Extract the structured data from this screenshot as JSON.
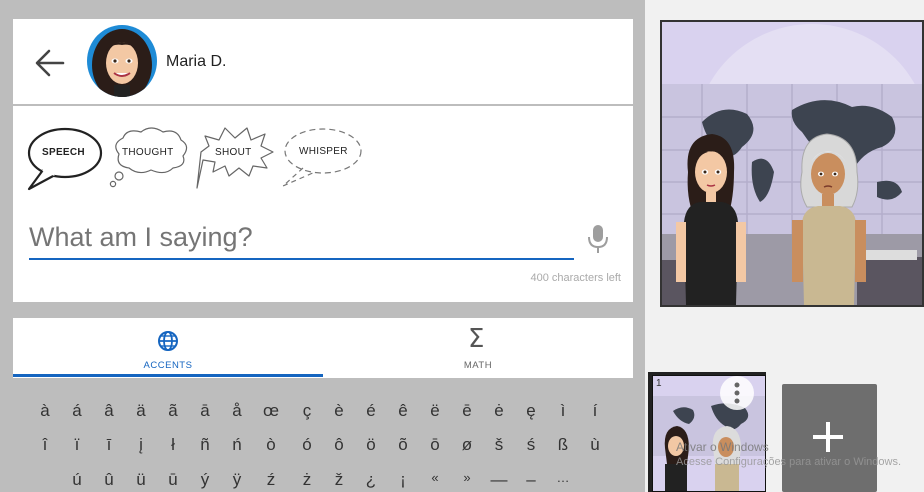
{
  "character": {
    "name": "Maria D."
  },
  "bubbles": [
    "SPEECH",
    "THOUGHT",
    "SHOUT",
    "WHISPER"
  ],
  "input": {
    "placeholder": "What am I saying?",
    "chars_left": "400 characters left"
  },
  "tabs": [
    {
      "label": "ACCENTS"
    },
    {
      "label": "MATH"
    }
  ],
  "keyboard": {
    "row1": [
      "à",
      "á",
      "â",
      "ä",
      "ã",
      "ā",
      "å",
      "œ",
      "ç",
      "è",
      "é",
      "ê",
      "ë",
      "ē",
      "ė",
      "ę",
      "ì",
      "í"
    ],
    "row2": [
      "î",
      "ï",
      "ī",
      "į",
      "ł",
      "ñ",
      "ń",
      "ò",
      "ó",
      "ô",
      "ö",
      "õ",
      "ō",
      "ø",
      "š",
      "ś",
      "ß",
      "ù"
    ],
    "row3": [
      "ú",
      "û",
      "ü",
      "ū",
      "ý",
      "ÿ",
      "ź",
      "ż",
      "ž",
      "¿",
      "¡",
      "«",
      "»",
      "—",
      "–",
      "…"
    ]
  },
  "thumbnail": {
    "page": "1"
  },
  "watermark": {
    "line1": "Ativar o Windows",
    "line2": "Acesse Configurações para ativar o Windows."
  },
  "colors": {
    "accent": "#1565c0",
    "panel_bg": "#d9d2ef"
  }
}
